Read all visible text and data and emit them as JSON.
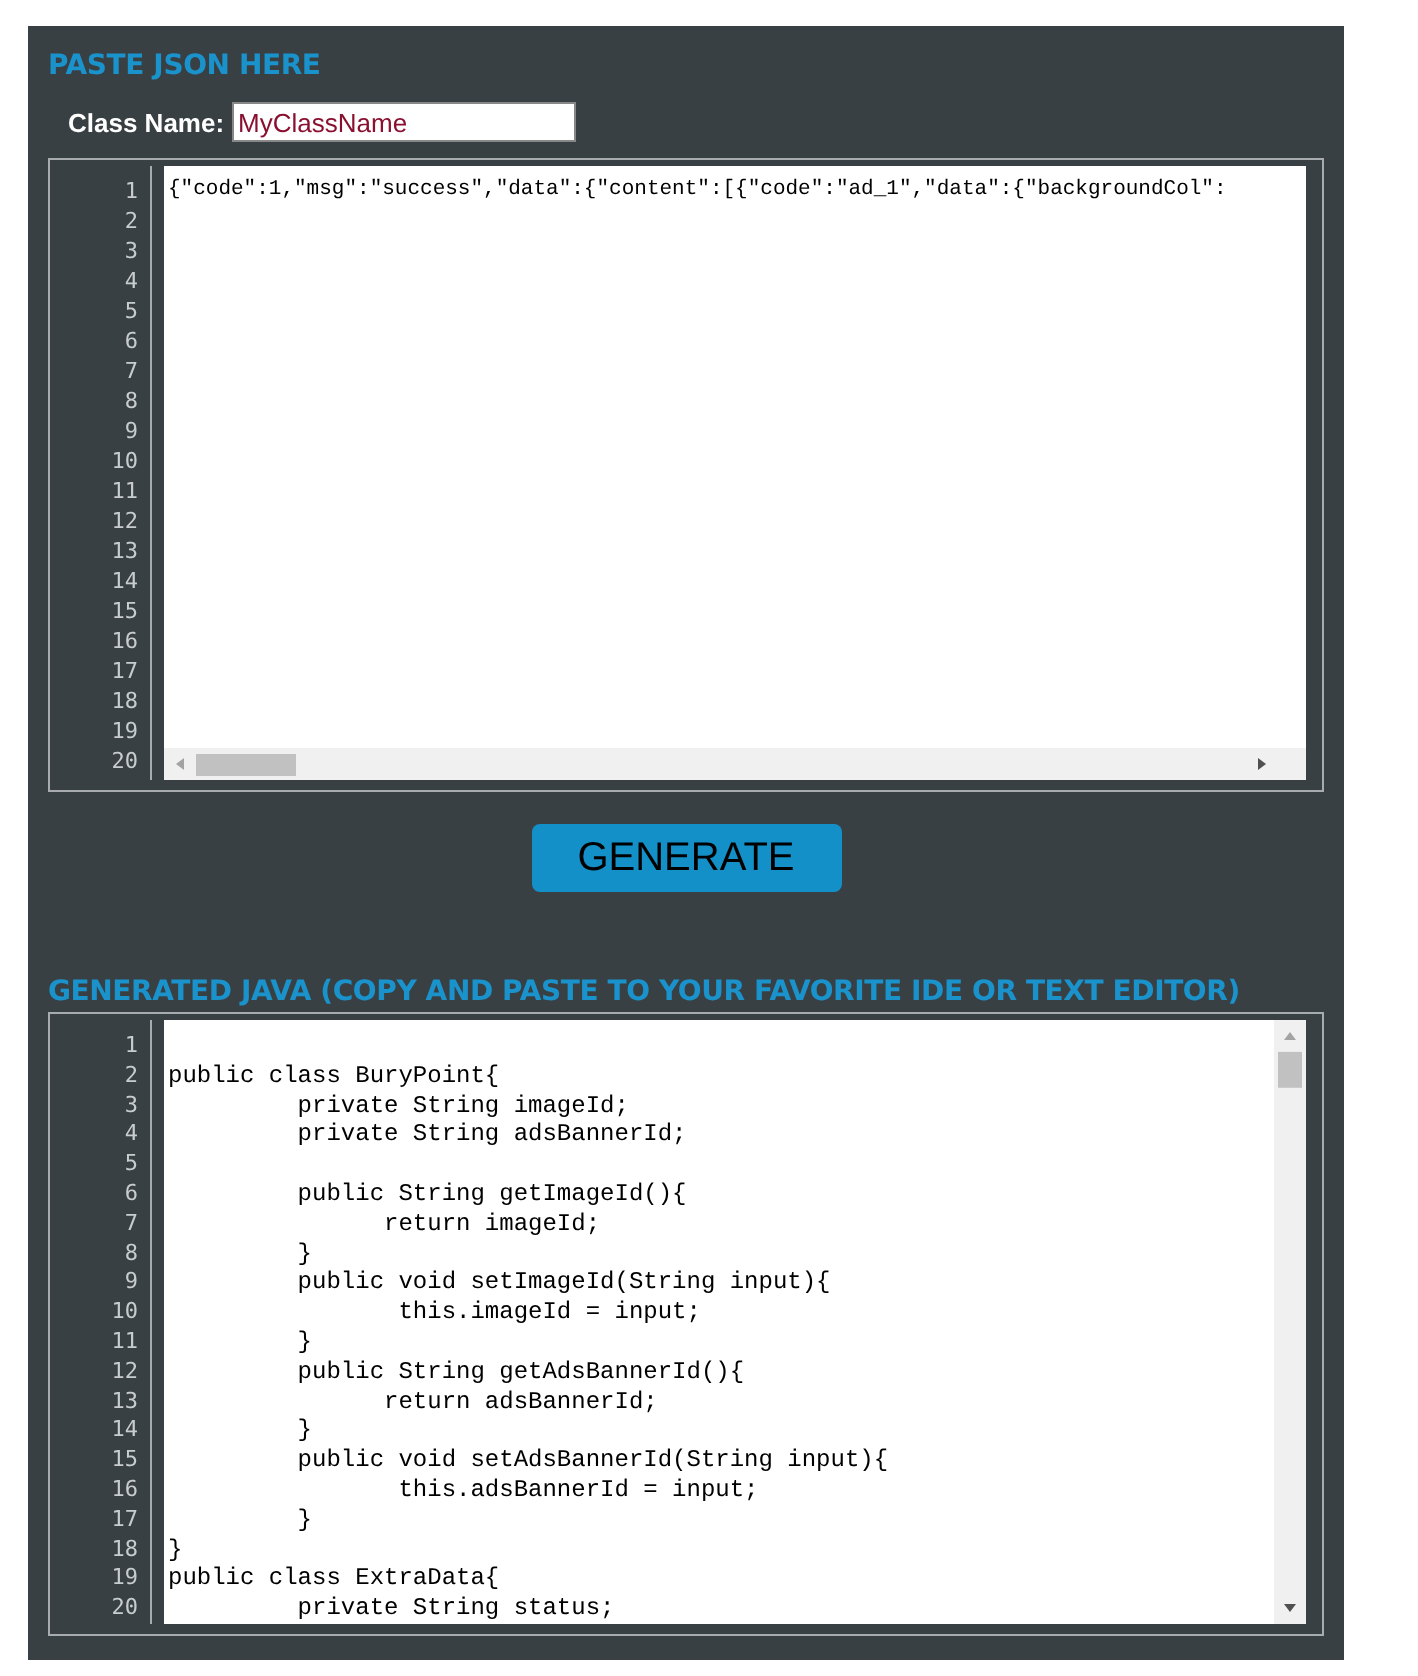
{
  "json_section": {
    "heading": "PASTE JSON HERE",
    "class_name": {
      "label": "Class Name:",
      "value": "MyClassName"
    },
    "editor": {
      "lines": [
        {
          "n": "1",
          "code": "{\"code\":1,\"msg\":\"success\",\"data\":{\"content\":[{\"code\":\"ad_1\",\"data\":{\"backgroundCol\":"
        },
        {
          "n": "2"
        },
        {
          "n": "3"
        },
        {
          "n": "4"
        },
        {
          "n": "5"
        },
        {
          "n": "6"
        },
        {
          "n": "7"
        },
        {
          "n": "8"
        },
        {
          "n": "9"
        },
        {
          "n": "10"
        },
        {
          "n": "11"
        },
        {
          "n": "12"
        },
        {
          "n": "13"
        },
        {
          "n": "14"
        },
        {
          "n": "15"
        },
        {
          "n": "16"
        },
        {
          "n": "17"
        },
        {
          "n": "18"
        },
        {
          "n": "19"
        },
        {
          "n": "20"
        }
      ]
    }
  },
  "generate_button": "GENERATE",
  "output_section": {
    "heading": "GENERATED JAVA (COPY AND PASTE TO YOUR FAVORITE IDE OR TEXT EDITOR)",
    "editor": {
      "lines": [
        {
          "n": "1"
        },
        {
          "n": "2",
          "code": "public class BuryPoint{"
        },
        {
          "n": "3",
          "code": "         private String imageId;"
        },
        {
          "n": "4",
          "code": "         private String adsBannerId;"
        },
        {
          "n": "5"
        },
        {
          "n": "6",
          "code": "         public String getImageId(){"
        },
        {
          "n": "7",
          "code": "               return imageId;"
        },
        {
          "n": "8",
          "code": "         }"
        },
        {
          "n": "9",
          "code": "         public void setImageId(String input){"
        },
        {
          "n": "10",
          "code": "                this.imageId = input;"
        },
        {
          "n": "11",
          "code": "         }"
        },
        {
          "n": "12",
          "code": "         public String getAdsBannerId(){"
        },
        {
          "n": "13",
          "code": "               return adsBannerId;"
        },
        {
          "n": "14",
          "code": "         }"
        },
        {
          "n": "15",
          "code": "         public void setAdsBannerId(String input){"
        },
        {
          "n": "16",
          "code": "                this.adsBannerId = input;"
        },
        {
          "n": "17",
          "code": "         }"
        },
        {
          "n": "18",
          "code": "}"
        },
        {
          "n": "19",
          "code": "public class ExtraData{"
        },
        {
          "n": "20",
          "code": "         private String status;"
        }
      ]
    }
  }
}
